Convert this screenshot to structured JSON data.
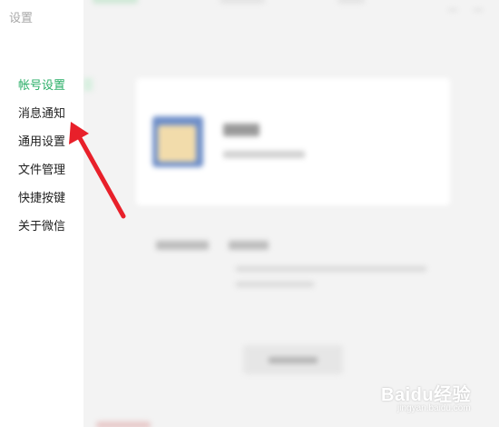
{
  "window": {
    "title": "设置"
  },
  "sidebar": {
    "items": [
      {
        "label": "帐号设置",
        "active": true
      },
      {
        "label": "消息通知",
        "active": false
      },
      {
        "label": "通用设置",
        "active": false
      },
      {
        "label": "文件管理",
        "active": false
      },
      {
        "label": "快捷按键",
        "active": false
      },
      {
        "label": "关于微信",
        "active": false
      }
    ]
  },
  "watermark": {
    "text": "Baidu经验",
    "sub": "jingyan.baidu.com"
  },
  "colors": {
    "active_text": "#2aae67",
    "arrow": "#e8202a"
  }
}
